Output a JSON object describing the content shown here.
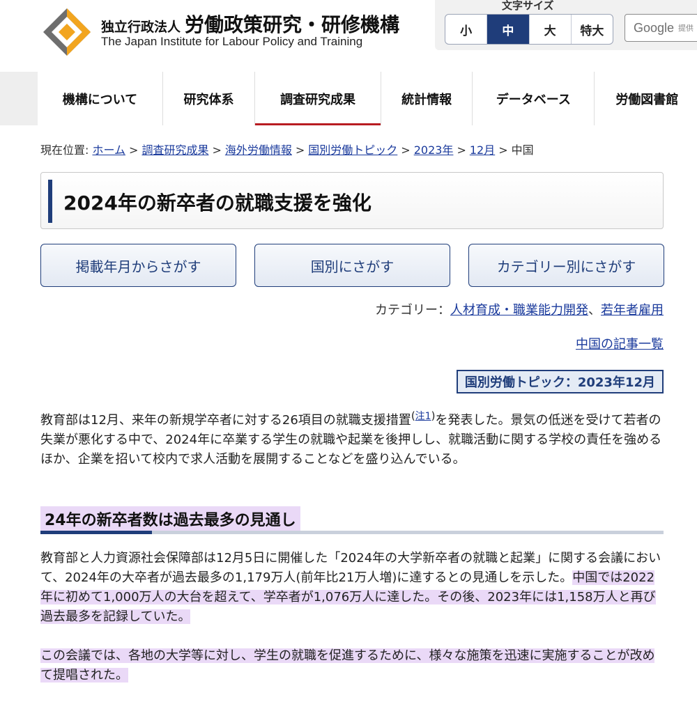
{
  "header": {
    "org_type": "独立行政法人",
    "org_name": "労働政策研究・研修機構",
    "org_name_en": "The Japan Institute for Labour Policy and Training",
    "logo_icon": "jil-diamond-logo"
  },
  "font_size": {
    "label": "文字サイズ",
    "options": [
      "小",
      "中",
      "大",
      "特大"
    ],
    "selected": "中"
  },
  "search": {
    "brand": "Google",
    "suffix": "提供"
  },
  "nav": {
    "items": [
      "機構について",
      "研究体系",
      "調査研究成果",
      "統計情報",
      "データベース",
      "労働図書館"
    ],
    "active": "調査研究成果"
  },
  "breadcrumb": {
    "prefix": "現在位置:",
    "links": [
      "ホーム",
      "調査研究成果",
      "海外労働情報",
      "国別労働トピック",
      "2023年",
      "12月"
    ],
    "current": "中国"
  },
  "article": {
    "title": "2024年の新卒者の就職支援を強化",
    "search_buttons": [
      "掲載年月からさがす",
      "国別にさがす",
      "カテゴリー別にさがす"
    ],
    "category_label": "カテゴリー：",
    "categories": [
      "人材育成・職業能力開発",
      "若年者雇用"
    ],
    "category_separator": "、",
    "country_link": "中国の記事一覧",
    "topic_badge": "国別労働トピック：2023年12月",
    "lead_before_note": "教育部は12月、来年の新規学卒者に対する26項目の就職支援措置",
    "note_link": "注1",
    "lead_after_note": "を発表した。景気の低迷を受けて若者の失業が悪化する中で、2024年に卒業する学生の就職や起業を後押しし、就職活動に関する学校の責任を強めるほか、企業を招いて校内で求人活動を展開することなどを盛り込んでいる。",
    "section_heading": "24年の新卒者数は過去最多の見通し",
    "para2_plain": "教育部と人力資源社会保障部は12月5日に開催した「2024年の大学新卒者の就職と起業」に関する会議において、2024年の大卒者が過去最多の1,179万人(前年比21万人増)に達するとの見通しを示した。",
    "para2_highlight": "中国では2022年に初めて1,000万人の大台を超えて、学卒者が1,076万人に達した。その後、2023年には1,158万人と再び過去最多を記録していた。",
    "para3_highlight": "この会議では、各地の大学等に対し、学生の就職を促進するために、様々な施策を迅速に実施することが改めて提唱された。"
  },
  "colors": {
    "navy": "#1f3d7a",
    "nav_active_underline": "#b81c22",
    "link": "#1a3a9c",
    "highlight": "#ead9f7",
    "logo_gray": "#6e6e6e",
    "logo_orange": "#f2a51f"
  }
}
